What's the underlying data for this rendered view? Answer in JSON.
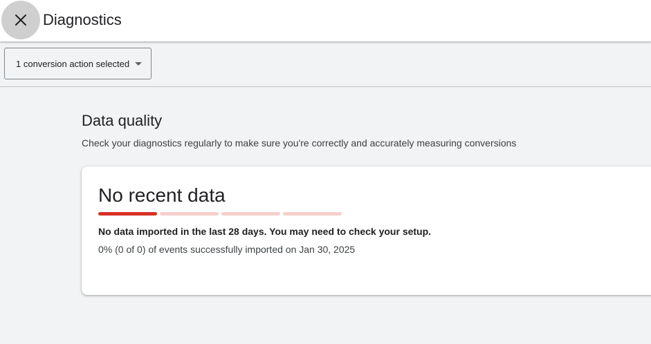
{
  "header": {
    "title": "Diagnostics",
    "close_icon": "close-icon"
  },
  "toolbar": {
    "conversion_dropdown": {
      "selected": "1 conversion action selected",
      "icon": "caret-down-icon"
    }
  },
  "data_quality": {
    "title": "Data quality",
    "subtitle": "Check your diagnostics regularly to make sure you're correctly and accurately measuring conversions",
    "card": {
      "status_title": "No recent data",
      "status_level": 1,
      "status_level_max": 4,
      "colors": {
        "active": "#d93025",
        "inactive": "#f6cfcc"
      },
      "message": "No data imported in the last 28 days. You may need to check your setup.",
      "detail": "0% (0 of 0) of events successfully imported on Jan 30, 2025"
    }
  },
  "colors": {
    "page_background": "#f1f3f4",
    "header_background": "#ffffff",
    "close_button_background": "#cfcfcf"
  }
}
